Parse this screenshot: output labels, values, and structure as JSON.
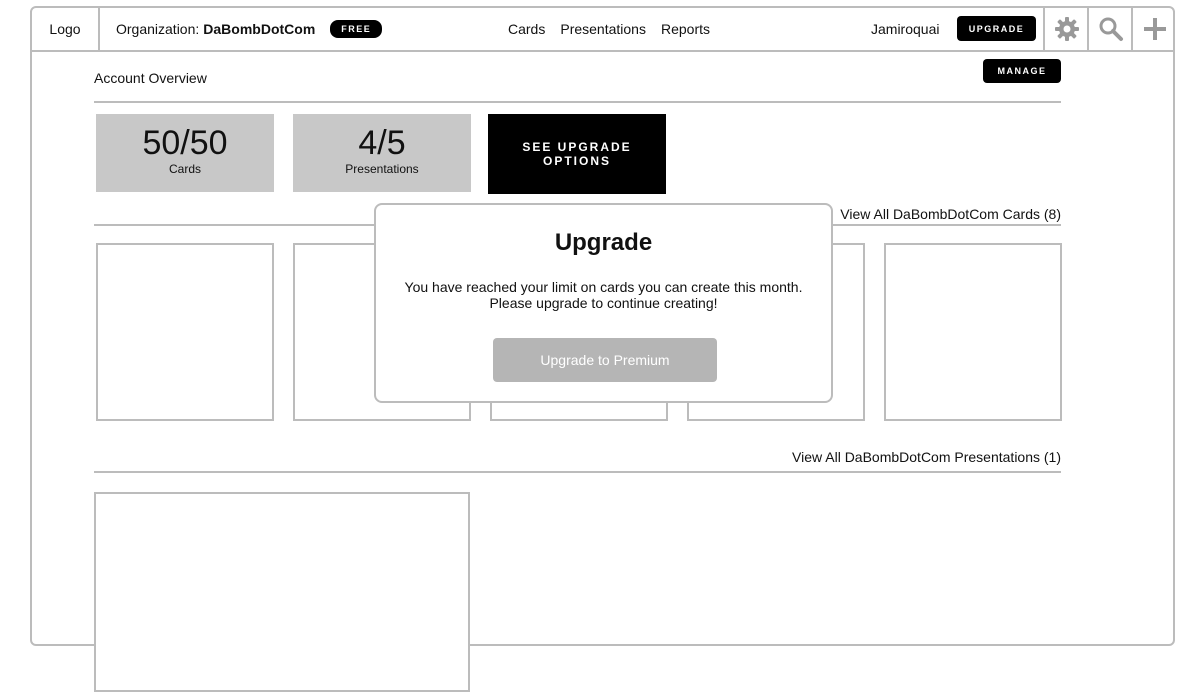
{
  "header": {
    "logo": "Logo",
    "org_label": "Organization:",
    "org_name": "DaBombDotCom",
    "plan_badge": "FREE",
    "nav": [
      "Cards",
      "Presentations",
      "Reports"
    ],
    "username": "Jamiroquai",
    "upgrade_label": "UPGRADE",
    "icons": [
      "gear-icon",
      "search-icon",
      "plus-icon"
    ]
  },
  "overview": {
    "title": "Account Overview",
    "manage_label": "MANAGE",
    "stats": [
      {
        "value": "50/50",
        "label": "Cards"
      },
      {
        "value": "4/5",
        "label": "Presentations"
      }
    ],
    "see_upgrade_line1": "SEE UPGRADE",
    "see_upgrade_line2": "OPTIONS"
  },
  "cards_section": {
    "view_all": "View All DaBombDotCom Cards (8)"
  },
  "presentations_section": {
    "view_all": "View All DaBombDotCom Presentations (1)"
  },
  "modal": {
    "title": "Upgrade",
    "line1": "You have reached your limit on cards you can create this month.",
    "line2": "Please upgrade to continue creating!",
    "button": "Upgrade to Premium"
  },
  "colors": {
    "accent": "#000000",
    "border": "#bcbcbc",
    "stat_bg": "#c8c8c8",
    "disabled_button": "#b5b5b5"
  }
}
